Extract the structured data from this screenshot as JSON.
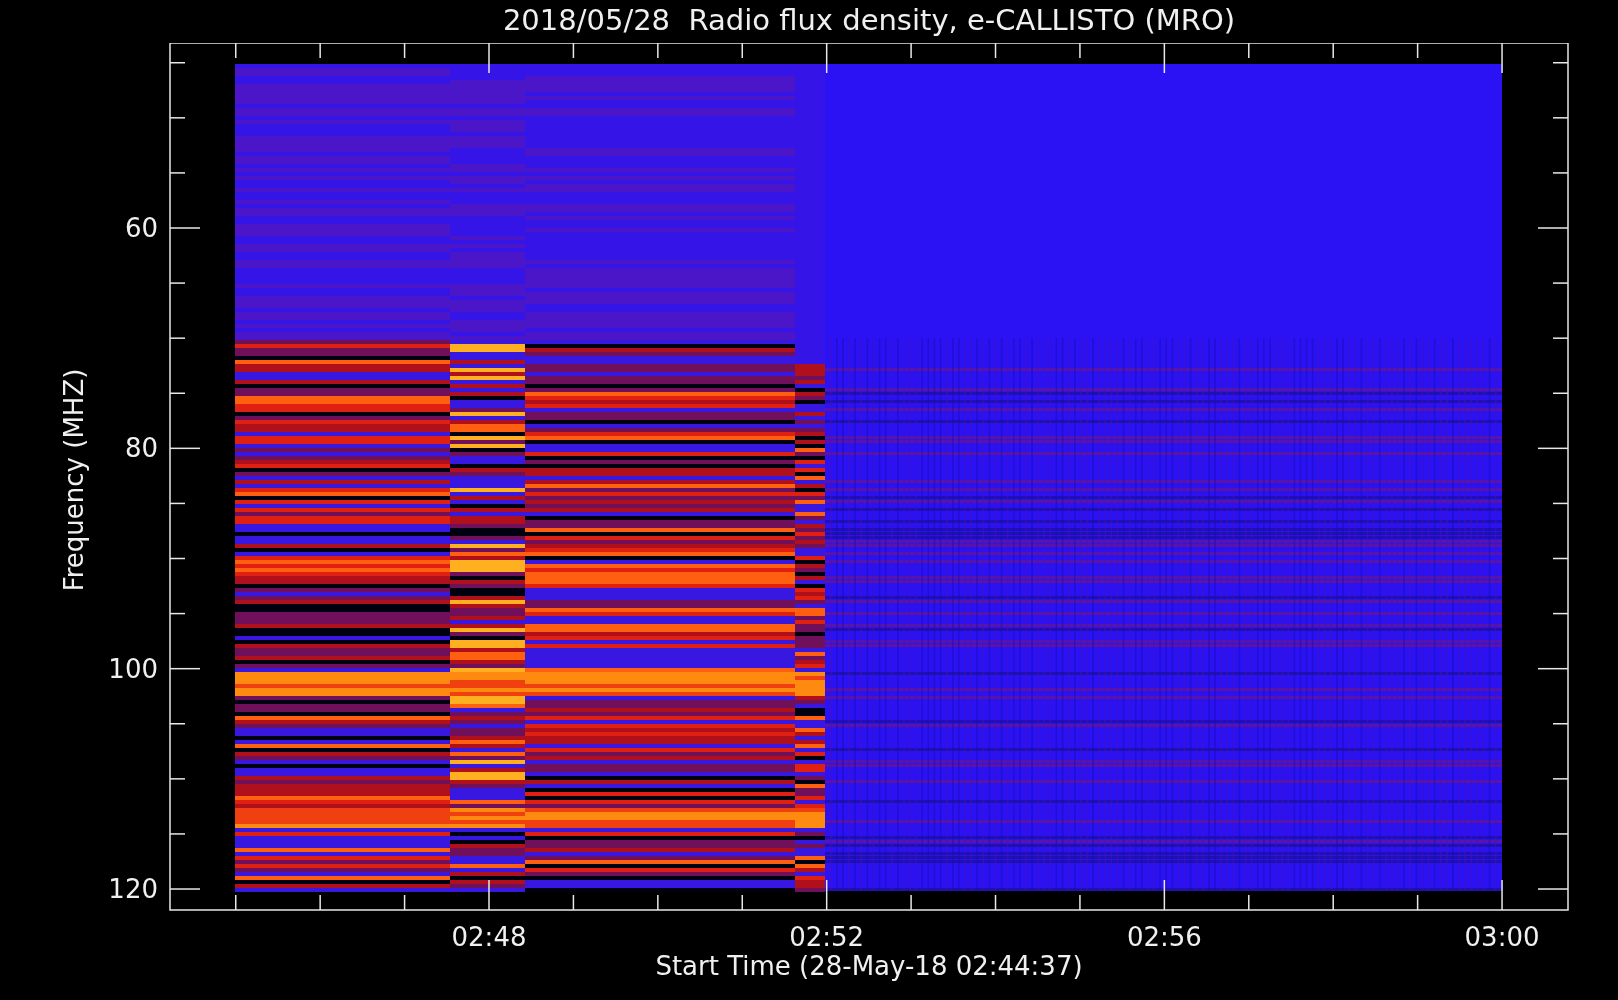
{
  "title": "2018/05/28  Radio flux density, e-CALLISTO (MRO)",
  "plot": {
    "xlabel": "Start Time (28-May-18 02:44:37)",
    "ylabel": "Frequency (MHZ)",
    "xticks": [
      "02:48",
      "02:52",
      "02:56",
      "03:00"
    ],
    "yticks": [
      "60",
      "80",
      "100",
      "120"
    ]
  }
}
